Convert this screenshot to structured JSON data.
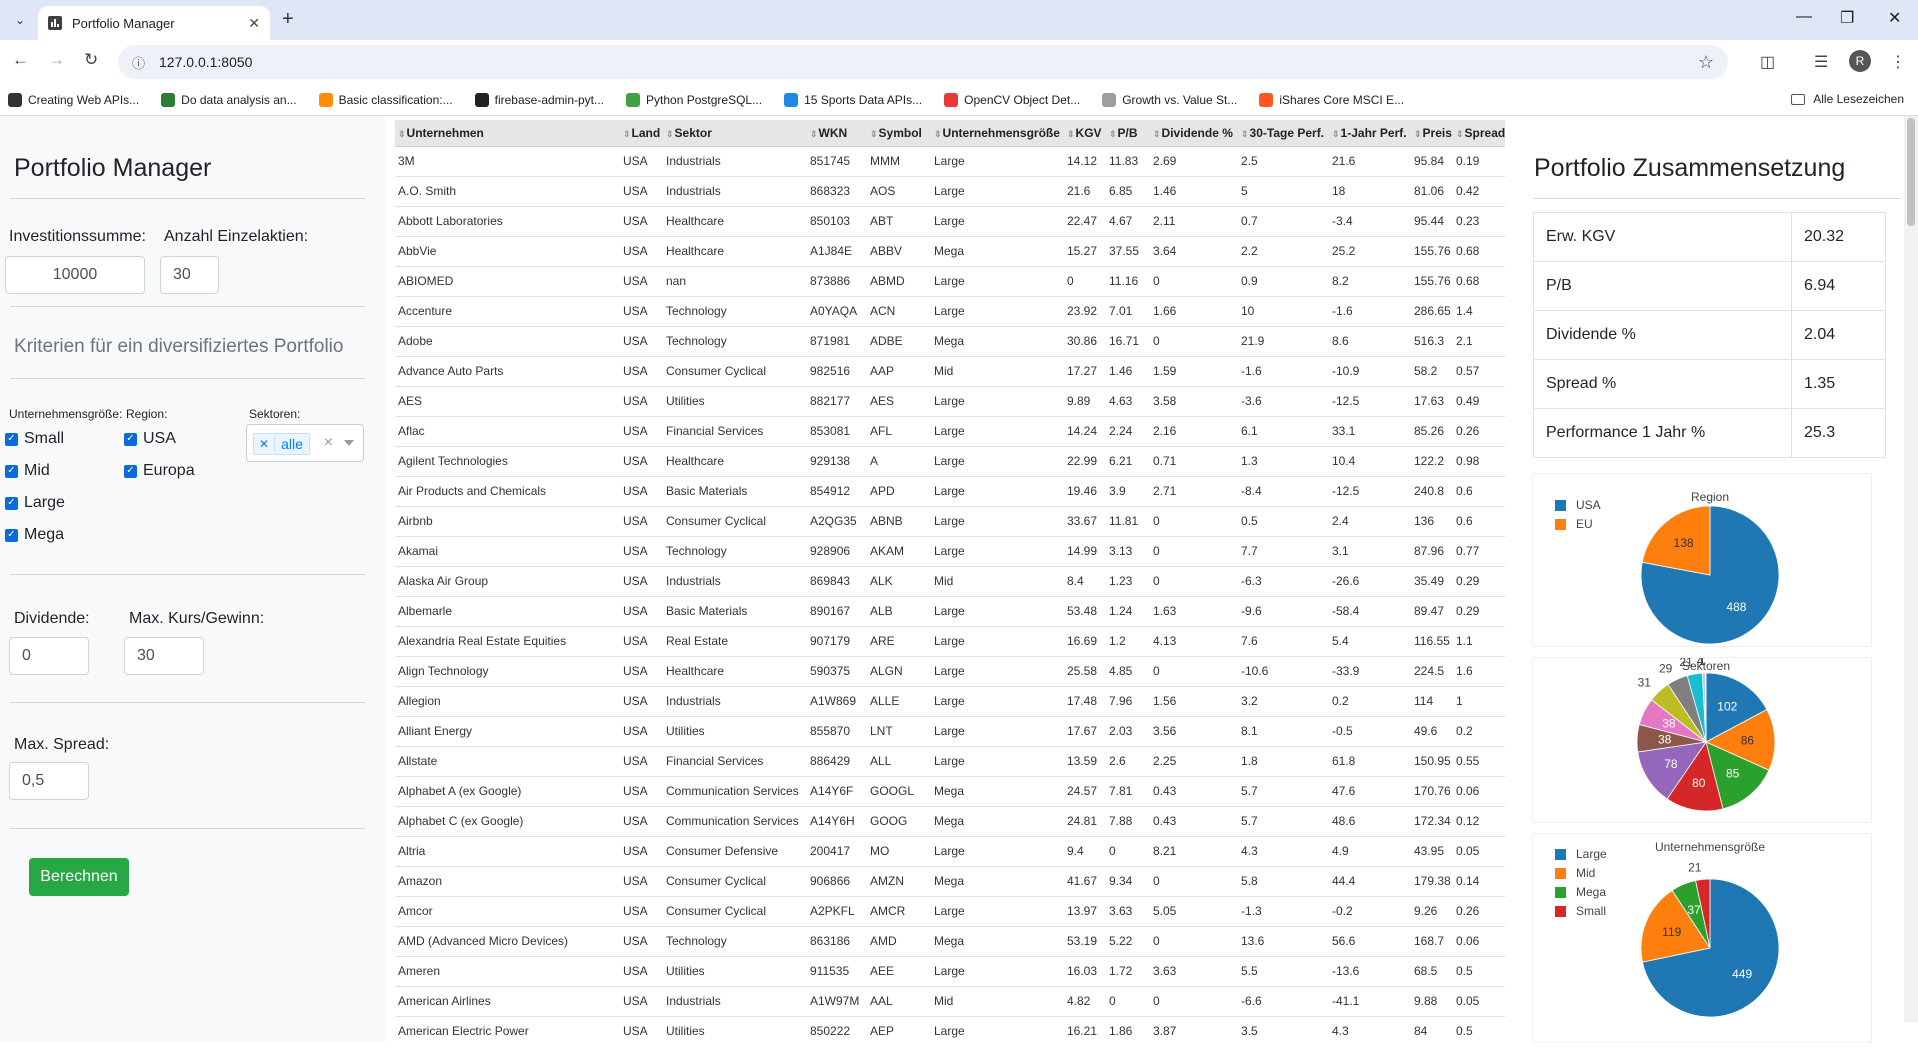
{
  "browser": {
    "tab_title": "Portfolio Manager",
    "url": "127.0.0.1:8050",
    "bookmarks": [
      {
        "label": "Creating Web APIs...",
        "color": "#333333"
      },
      {
        "label": "Do data analysis an...",
        "color": "#2e7d32"
      },
      {
        "label": "Basic classification:...",
        "color": "#ff8f00"
      },
      {
        "label": "firebase-admin-pyt...",
        "color": "#222222"
      },
      {
        "label": "Python PostgreSQL...",
        "color": "#43a047"
      },
      {
        "label": "15 Sports Data APIs...",
        "color": "#1e88e5"
      },
      {
        "label": "OpenCV Object Det...",
        "color": "#e53935"
      },
      {
        "label": "Growth vs. Value St...",
        "color": "#9e9e9e"
      },
      {
        "label": "iShares Core MSCI E...",
        "color": "#ff5722"
      }
    ],
    "all_bookmarks": "Alle Lesezeichen",
    "profile_initial": "R"
  },
  "sidebar": {
    "title": "Portfolio Manager",
    "investment_label": "Investitionssumme:",
    "investment_value": "10000",
    "count_label": "Anzahl Einzelaktien:",
    "count_value": "30",
    "criteria_title": "Kriterien für ein diversifiziertes Portfolio",
    "size_label": "Unternehmensgröße:",
    "region_label": "Region:",
    "sectors_label": "Sektoren:",
    "sizes": [
      "Small",
      "Mid",
      "Large",
      "Mega"
    ],
    "regions": [
      "USA",
      "Europa"
    ],
    "sector_tag": "alle",
    "dividend_label": "Dividende:",
    "dividend_value": "0",
    "max_pe_label": "Max. Kurs/Gewinn:",
    "max_pe_value": "30",
    "max_spread_label": "Max. Spread:",
    "max_spread_value": "0,5",
    "calc_button": "Berechnen"
  },
  "table": {
    "columns": [
      "Unternehmen",
      "Land",
      "Sektor",
      "WKN",
      "Symbol",
      "Unternehmensgröße",
      "KGV",
      "P/B",
      "Dividende %",
      "30-Tage Perf.",
      "1-Jahr Perf.",
      "Preis",
      "Spread"
    ],
    "rows": [
      [
        "3M",
        "USA",
        "Industrials",
        "851745",
        "MMM",
        "Large",
        "14.12",
        "11.83",
        "2.69",
        "2.5",
        "21.6",
        "95.84",
        "0.19"
      ],
      [
        "A.O. Smith",
        "USA",
        "Industrials",
        "868323",
        "AOS",
        "Large",
        "21.6",
        "6.85",
        "1.46",
        "5",
        "18",
        "81.06",
        "0.42"
      ],
      [
        "Abbott Laboratories",
        "USA",
        "Healthcare",
        "850103",
        "ABT",
        "Large",
        "22.47",
        "4.67",
        "2.11",
        "0.7",
        "-3.4",
        "95.44",
        "0.23"
      ],
      [
        "AbbVie",
        "USA",
        "Healthcare",
        "A1J84E",
        "ABBV",
        "Mega",
        "15.27",
        "37.55",
        "3.64",
        "2.2",
        "25.2",
        "155.76",
        "0.68"
      ],
      [
        "ABIOMED",
        "USA",
        "nan",
        "873886",
        "ABMD",
        "Large",
        "0",
        "11.16",
        "0",
        "0.9",
        "8.2",
        "155.76",
        "0.68"
      ],
      [
        "Accenture",
        "USA",
        "Technology",
        "A0YAQA",
        "ACN",
        "Large",
        "23.92",
        "7.01",
        "1.66",
        "10",
        "-1.6",
        "286.65",
        "1.4"
      ],
      [
        "Adobe",
        "USA",
        "Technology",
        "871981",
        "ADBE",
        "Mega",
        "30.86",
        "16.71",
        "0",
        "21.9",
        "8.6",
        "516.3",
        "2.1"
      ],
      [
        "Advance Auto Parts",
        "USA",
        "Consumer Cyclical",
        "982516",
        "AAP",
        "Mid",
        "17.27",
        "1.46",
        "1.59",
        "-1.6",
        "-10.9",
        "58.2",
        "0.57"
      ],
      [
        "AES",
        "USA",
        "Utilities",
        "882177",
        "AES",
        "Large",
        "9.89",
        "4.63",
        "3.58",
        "-3.6",
        "-12.5",
        "17.63",
        "0.49"
      ],
      [
        "Aflac",
        "USA",
        "Financial Services",
        "853081",
        "AFL",
        "Large",
        "14.24",
        "2.24",
        "2.16",
        "6.1",
        "33.1",
        "85.26",
        "0.26"
      ],
      [
        "Agilent Technologies",
        "USA",
        "Healthcare",
        "929138",
        "A",
        "Large",
        "22.99",
        "6.21",
        "0.71",
        "1.3",
        "10.4",
        "122.2",
        "0.98"
      ],
      [
        "Air Products and Chemicals",
        "USA",
        "Basic Materials",
        "854912",
        "APD",
        "Large",
        "19.46",
        "3.9",
        "2.71",
        "-8.4",
        "-12.5",
        "240.8",
        "0.6"
      ],
      [
        "Airbnb",
        "USA",
        "Consumer Cyclical",
        "A2QG35",
        "ABNB",
        "Large",
        "33.67",
        "11.81",
        "0",
        "0.5",
        "2.4",
        "136",
        "0.6"
      ],
      [
        "Akamai",
        "USA",
        "Technology",
        "928906",
        "AKAM",
        "Large",
        "14.99",
        "3.13",
        "0",
        "7.7",
        "3.1",
        "87.96",
        "0.77"
      ],
      [
        "Alaska Air Group",
        "USA",
        "Industrials",
        "869843",
        "ALK",
        "Mid",
        "8.4",
        "1.23",
        "0",
        "-6.3",
        "-26.6",
        "35.49",
        "0.29"
      ],
      [
        "Albemarle",
        "USA",
        "Basic Materials",
        "890167",
        "ALB",
        "Large",
        "53.48",
        "1.24",
        "1.63",
        "-9.6",
        "-58.4",
        "89.47",
        "0.29"
      ],
      [
        "Alexandria Real Estate Equities",
        "USA",
        "Real Estate",
        "907179",
        "ARE",
        "Large",
        "16.69",
        "1.2",
        "4.13",
        "7.6",
        "5.4",
        "116.55",
        "1.1"
      ],
      [
        "Align Technology",
        "USA",
        "Healthcare",
        "590375",
        "ALGN",
        "Large",
        "25.58",
        "4.85",
        "0",
        "-10.6",
        "-33.9",
        "224.5",
        "1.6"
      ],
      [
        "Allegion",
        "USA",
        "Industrials",
        "A1W869",
        "ALLE",
        "Large",
        "17.48",
        "7.96",
        "1.56",
        "3.2",
        "0.2",
        "114",
        "1"
      ],
      [
        "Alliant Energy",
        "USA",
        "Utilities",
        "855870",
        "LNT",
        "Large",
        "17.67",
        "2.03",
        "3.56",
        "8.1",
        "-0.5",
        "49.6",
        "0.2"
      ],
      [
        "Allstate",
        "USA",
        "Financial Services",
        "886429",
        "ALL",
        "Large",
        "13.59",
        "2.6",
        "2.25",
        "1.8",
        "61.8",
        "150.95",
        "0.55"
      ],
      [
        "Alphabet A (ex Google)",
        "USA",
        "Communication Services",
        "A14Y6F",
        "GOOGL",
        "Mega",
        "24.57",
        "7.81",
        "0.43",
        "5.7",
        "47.6",
        "170.76",
        "0.06"
      ],
      [
        "Alphabet C (ex Google)",
        "USA",
        "Communication Services",
        "A14Y6H",
        "GOOG",
        "Mega",
        "24.81",
        "7.88",
        "0.43",
        "5.7",
        "48.6",
        "172.34",
        "0.12"
      ],
      [
        "Altria",
        "USA",
        "Consumer Defensive",
        "200417",
        "MO",
        "Large",
        "9.4",
        "0",
        "8.21",
        "4.3",
        "4.9",
        "43.95",
        "0.05"
      ],
      [
        "Amazon",
        "USA",
        "Consumer Cyclical",
        "906866",
        "AMZN",
        "Mega",
        "41.67",
        "9.34",
        "0",
        "5.8",
        "44.4",
        "179.38",
        "0.14"
      ],
      [
        "Amcor",
        "USA",
        "Consumer Cyclical",
        "A2PKFL",
        "AMCR",
        "Large",
        "13.97",
        "3.63",
        "5.05",
        "-1.3",
        "-0.2",
        "9.26",
        "0.26"
      ],
      [
        "AMD (Advanced Micro Devices)",
        "USA",
        "Technology",
        "863186",
        "AMD",
        "Mega",
        "53.19",
        "5.22",
        "0",
        "13.6",
        "56.6",
        "168.7",
        "0.06"
      ],
      [
        "Ameren",
        "USA",
        "Utilities",
        "911535",
        "AEE",
        "Large",
        "16.03",
        "1.72",
        "3.63",
        "5.5",
        "-13.6",
        "68.5",
        "0.5"
      ],
      [
        "American Airlines",
        "USA",
        "Industrials",
        "A1W97M",
        "AAL",
        "Mid",
        "4.82",
        "0",
        "0",
        "-6.6",
        "-41.1",
        "9.88",
        "0.05"
      ],
      [
        "American Electric Power",
        "USA",
        "Utilities",
        "850222",
        "AEP",
        "Large",
        "16.21",
        "1.86",
        "3.87",
        "3.5",
        "4.3",
        "84",
        "0.5"
      ]
    ]
  },
  "summary": {
    "title": "Portfolio Zusammensetzung",
    "stats": [
      {
        "label": "Erw. KGV",
        "value": "20.32"
      },
      {
        "label": "P/B",
        "value": "6.94"
      },
      {
        "label": "Dividende %",
        "value": "2.04"
      },
      {
        "label": "Spread %",
        "value": "1.35"
      },
      {
        "label": "Performance 1 Jahr %",
        "value": "25.3"
      }
    ]
  },
  "chart_data": [
    {
      "type": "pie",
      "title": "Region",
      "categories": [
        "USA",
        "EU"
      ],
      "values": [
        488,
        138
      ],
      "colors": [
        "#1f77b4",
        "#ff7f0e"
      ],
      "legend": "top-left"
    },
    {
      "type": "pie",
      "title": "Sektoren",
      "values": [
        102,
        86,
        85,
        80,
        78,
        38,
        38,
        31,
        29,
        21,
        4,
        1
      ],
      "colors": [
        "#1f77b4",
        "#ff7f0e",
        "#2ca02c",
        "#d62728",
        "#9467bd",
        "#8c564b",
        "#e377c2",
        "#bcbd22",
        "#7f7f7f",
        "#17becf",
        "#aec7e8",
        "#ffbb78"
      ],
      "legend": "none"
    },
    {
      "type": "pie",
      "title": "Unternehmensgröße",
      "categories": [
        "Large",
        "Mid",
        "Mega",
        "Small"
      ],
      "values": [
        449,
        119,
        37,
        21
      ],
      "colors": [
        "#1f77b4",
        "#ff7f0e",
        "#2ca02c",
        "#d62728"
      ],
      "legend": "top-left"
    }
  ]
}
